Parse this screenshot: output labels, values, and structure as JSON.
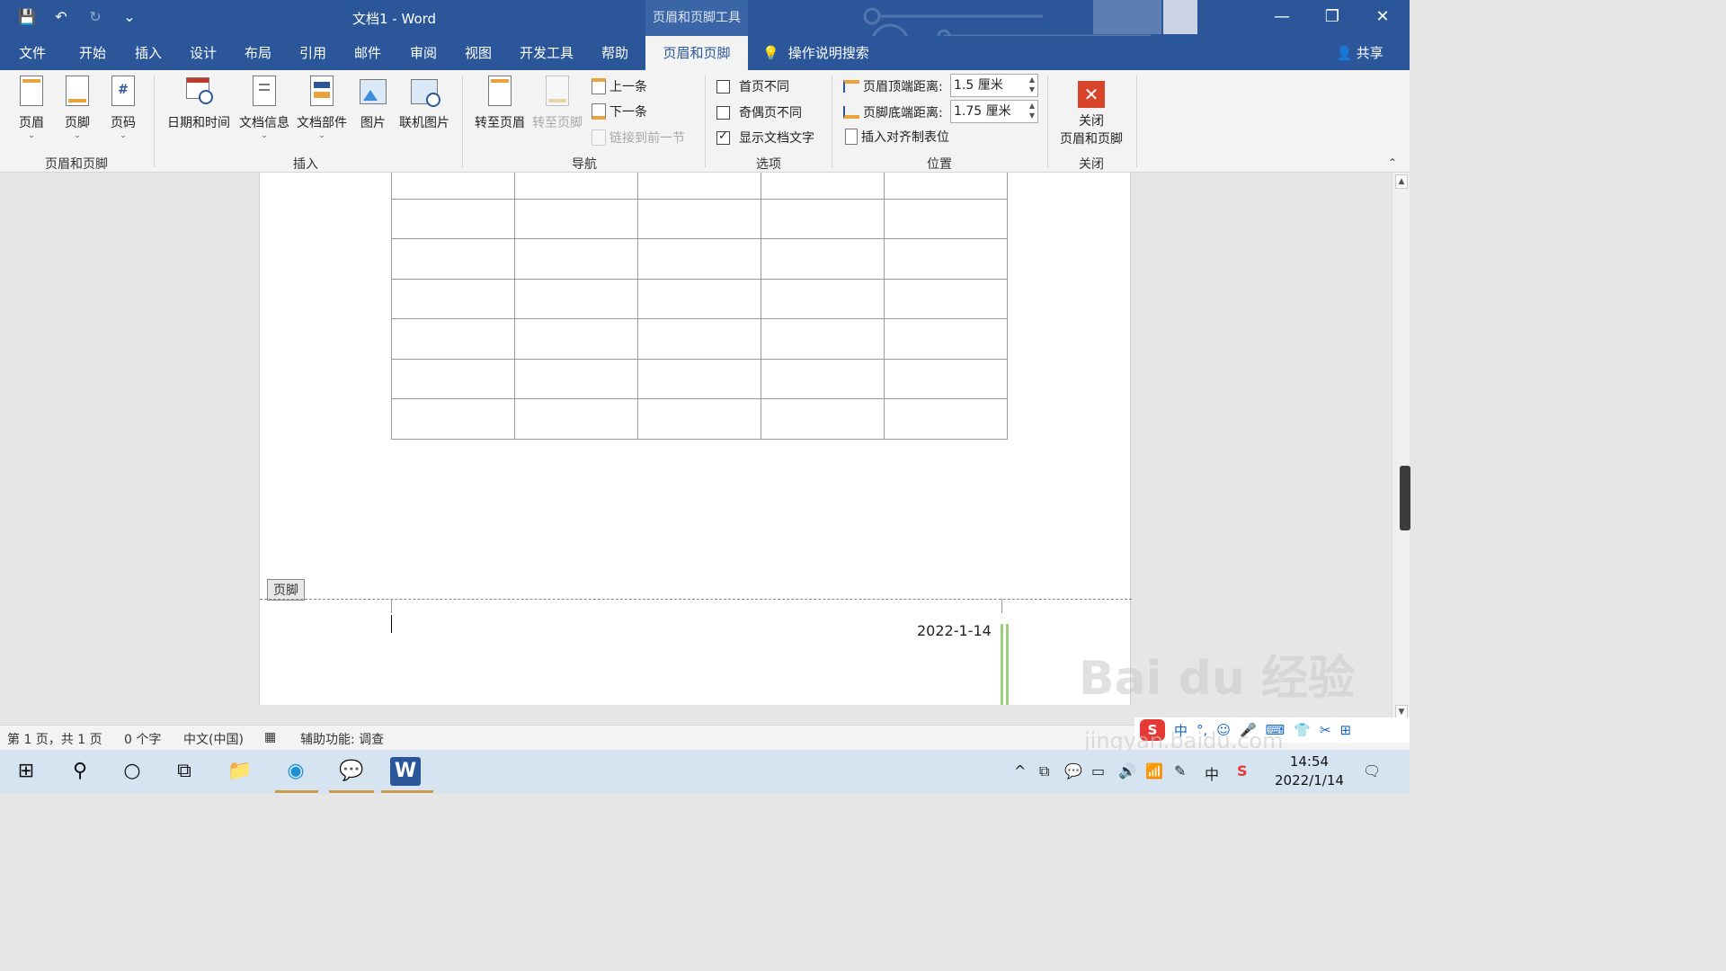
{
  "titlebar": {
    "doc_title": "文档1  -  Word",
    "context_tab_title": "页眉和页脚工具",
    "qat": {
      "save_icon": "💾",
      "undo_icon": "↶",
      "undo_drop": "⌄",
      "redo_icon": "↻",
      "customize_icon": "⌄"
    },
    "minimize": "—",
    "restore": "❐",
    "close": "✕"
  },
  "tabs": [
    {
      "label": "文件"
    },
    {
      "label": "开始"
    },
    {
      "label": "插入"
    },
    {
      "label": "设计"
    },
    {
      "label": "布局"
    },
    {
      "label": "引用"
    },
    {
      "label": "邮件"
    },
    {
      "label": "审阅"
    },
    {
      "label": "视图"
    },
    {
      "label": "开发工具"
    },
    {
      "label": "帮助"
    },
    {
      "label": "页眉和页脚"
    }
  ],
  "tellme": {
    "icon": "💡",
    "label": "操作说明搜索"
  },
  "share": {
    "icon": "👤",
    "label": "共享"
  },
  "ribbon": {
    "groups": {
      "header_footer": "页眉和页脚",
      "insert": "插入",
      "navigation": "导航",
      "options": "选项",
      "position": "位置",
      "close": "关闭"
    },
    "header_btn": "页眉",
    "footer_btn": "页脚",
    "pagenum_btn": "页码",
    "pagenum_glyph": "#",
    "datetime_btn": "日期和时间",
    "docinfo_btn": "文档信息",
    "docparts_btn": "文档部件",
    "picture_btn": "图片",
    "online_picture_btn": "联机图片",
    "goto_header_btn": "转至页眉",
    "goto_footer_btn": "转至页脚",
    "previous_btn": "上一条",
    "next_btn": "下一条",
    "link_previous_btn": "链接到前一节",
    "different_first": "首页不同",
    "different_odd_even": "奇偶页不同",
    "show_doc_text": "显示文档文字",
    "header_top_label": "页眉顶端距离:",
    "header_top_value": "1.5 厘米",
    "footer_bottom_label": "页脚底端距离:",
    "footer_bottom_value": "1.75 厘米",
    "insert_align_tab": "插入对齐制表位",
    "close_btn_line1": "关闭",
    "close_btn_line2": "页眉和页脚",
    "drop": "⌄",
    "collapse": "⌃"
  },
  "document": {
    "footer_tag": "页脚",
    "footer_date": "2022-1-14",
    "table_rows": 7,
    "table_cols": 5
  },
  "scroll": {
    "up": "▲",
    "down": "▼"
  },
  "statusbar": {
    "page": "第 1 页，共 1 页",
    "words": "0 个字",
    "language": "中文(中国)",
    "accessibility": "辅助功能: 调查",
    "view_icon": "▦"
  },
  "ime": {
    "logo": "S",
    "mode": "中",
    "punct": "°,",
    "items": [
      "☺",
      "🎤",
      "⌨",
      "👕",
      "✂",
      "⊞"
    ]
  },
  "watermark": {
    "main": "Bai du 经验",
    "sub": "jingyan.baidu.com"
  },
  "taskbar": {
    "start_icon": "⊞",
    "search_icon": "⚲",
    "cortana_icon": "○",
    "taskview_icon": "⧉",
    "explorer_icon": "📁",
    "edge_icon": "◉",
    "wechat_icon": "💬",
    "word_icon": "W",
    "tray": [
      "^",
      "⧉",
      "💬",
      "▭",
      "🔊",
      "📶",
      "✎",
      "中",
      "S"
    ],
    "time": "14:54",
    "date": "2022/1/14",
    "notify_icon": "🗨"
  }
}
